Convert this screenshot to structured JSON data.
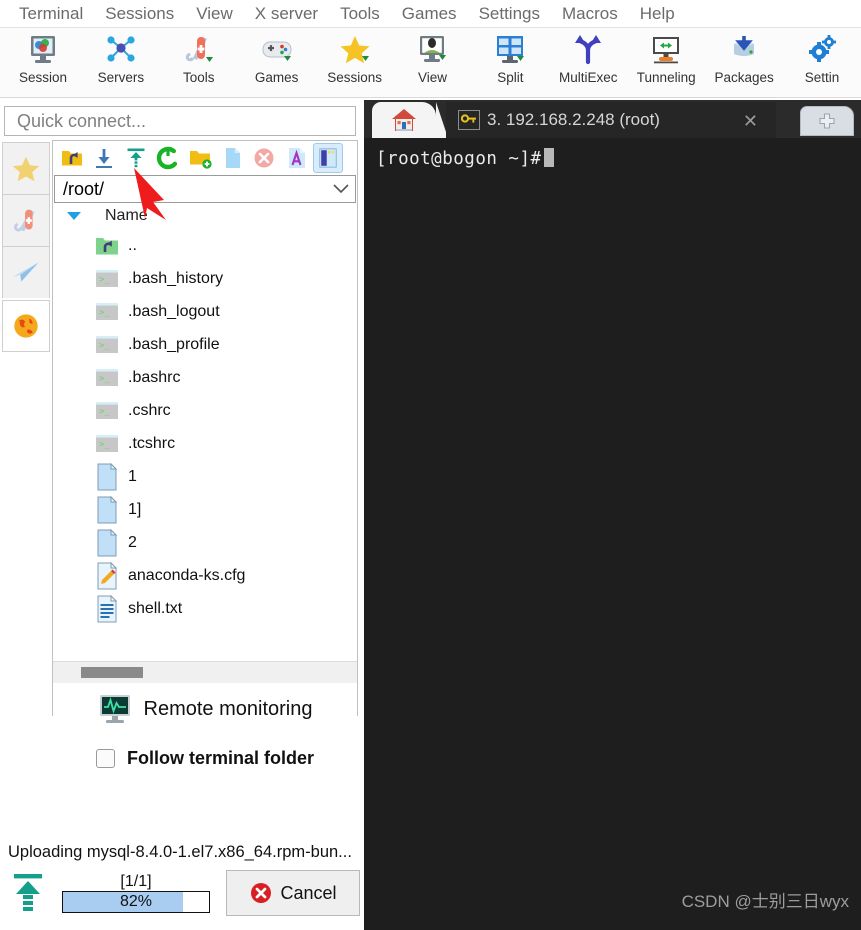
{
  "menubar": {
    "items": [
      {
        "label": "Terminal"
      },
      {
        "label": "Sessions"
      },
      {
        "label": "View"
      },
      {
        "label": "X server"
      },
      {
        "label": "Tools"
      },
      {
        "label": "Games"
      },
      {
        "label": "Settings"
      },
      {
        "label": "Macros"
      },
      {
        "label": "Help"
      }
    ]
  },
  "toolbar": {
    "items": [
      {
        "label": "Session",
        "icon": "session-icon"
      },
      {
        "label": "Servers",
        "icon": "servers-icon"
      },
      {
        "label": "Tools",
        "icon": "tools-icon"
      },
      {
        "label": "Games",
        "icon": "games-icon"
      },
      {
        "label": "Sessions",
        "icon": "sessions-star-icon"
      },
      {
        "label": "View",
        "icon": "view-icon"
      },
      {
        "label": "Split",
        "icon": "split-icon"
      },
      {
        "label": "MultiExec",
        "icon": "multiexec-icon"
      },
      {
        "label": "Tunneling",
        "icon": "tunneling-icon"
      },
      {
        "label": "Packages",
        "icon": "packages-icon"
      },
      {
        "label": "Settin",
        "icon": "settings-icon"
      }
    ]
  },
  "quick_connect": {
    "placeholder": "Quick connect...",
    "value": ""
  },
  "rail": {
    "items": [
      {
        "name": "favorites-star-icon"
      },
      {
        "name": "tools-knife-icon"
      },
      {
        "name": "send-paperplane-icon"
      },
      {
        "name": "globe-icon"
      }
    ]
  },
  "sftp": {
    "toolbar_buttons": [
      {
        "name": "parent-folder-icon",
        "active": false
      },
      {
        "name": "download-icon",
        "active": false
      },
      {
        "name": "upload-icon",
        "active": false
      },
      {
        "name": "refresh-icon",
        "active": false
      },
      {
        "name": "new-folder-icon",
        "active": false
      },
      {
        "name": "new-file-icon",
        "active": false
      },
      {
        "name": "delete-icon",
        "active": false
      },
      {
        "name": "text-mode-icon",
        "active": false
      },
      {
        "name": "toggle-panel-icon",
        "active": true
      }
    ],
    "path": "/root/",
    "column_header": "Name",
    "sort_direction": "descending",
    "files": [
      {
        "name": "..",
        "icon": "parent-dir-icon"
      },
      {
        "name": ".bash_history",
        "icon": "script-file-icon"
      },
      {
        "name": ".bash_logout",
        "icon": "script-file-icon"
      },
      {
        "name": ".bash_profile",
        "icon": "script-file-icon"
      },
      {
        "name": ".bashrc",
        "icon": "script-file-icon"
      },
      {
        "name": ".cshrc",
        "icon": "script-file-icon"
      },
      {
        "name": ".tcshrc",
        "icon": "script-file-icon"
      },
      {
        "name": "1",
        "icon": "plain-file-icon"
      },
      {
        "name": "1]",
        "icon": "plain-file-icon"
      },
      {
        "name": "2",
        "icon": "plain-file-icon"
      },
      {
        "name": "anaconda-ks.cfg",
        "icon": "config-file-icon"
      },
      {
        "name": "shell.txt",
        "icon": "text-file-icon"
      }
    ],
    "remote_monitoring_label": "Remote monitoring",
    "follow_terminal_label": "Follow terminal folder",
    "follow_terminal_checked": false
  },
  "transfer": {
    "status_text": "Uploading mysql-8.4.0-1.el7.x86_64.rpm-bun...",
    "count": "[1/1]",
    "percent_label": "82%",
    "percent_value": 82,
    "cancel_label": "Cancel",
    "direction_icon": "upload-arrow-icon"
  },
  "tabs": {
    "home_icon": "home-icon",
    "active": {
      "icon": "key-icon",
      "title": "3. 192.168.2.248 (root)",
      "close": "✕"
    },
    "new_tab_icon": "plus-icon"
  },
  "terminal": {
    "prompt": "[root@bogon ~]#",
    "watermark": "CSDN @士别三日wyx"
  },
  "annotation": {
    "arrow": "red-pointer-arrow",
    "color": "#ee1c1c"
  },
  "colors": {
    "accent_blue": "#1e9fe8",
    "progress_fill": "#a8cdf0",
    "terminal_bg": "#1e1e1e",
    "tab_bg": "#262626",
    "panel_border": "#c0c0c0"
  }
}
